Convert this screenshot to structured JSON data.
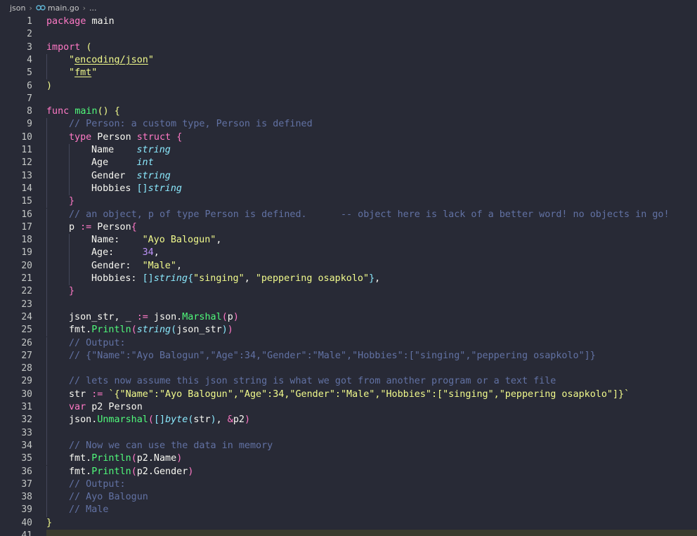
{
  "breadcrumb": {
    "folder": "json",
    "file": "main.go",
    "tail": "..."
  },
  "colors": {
    "background": "#282a36",
    "keyword": "#ff79c6",
    "function": "#50fa7b",
    "type": "#8be9fd",
    "string": "#f1fa8c",
    "number": "#bd93f9",
    "comment": "#6272a4"
  },
  "icons": {
    "go_file": "go-file-icon",
    "separator": "chevron-right-icon"
  },
  "lines": [
    {
      "n": "1",
      "indent": 0,
      "tokens": [
        [
          "kw",
          "package"
        ],
        [
          "pl",
          " main"
        ]
      ]
    },
    {
      "n": "2",
      "indent": 0,
      "tokens": []
    },
    {
      "n": "3",
      "indent": 0,
      "tokens": [
        [
          "kw",
          "import"
        ],
        [
          "pl",
          " "
        ],
        [
          "br1",
          "("
        ]
      ]
    },
    {
      "n": "4",
      "indent": 1,
      "tokens": [
        [
          "str",
          "\""
        ],
        [
          "str ul",
          "encoding/json"
        ],
        [
          "str",
          "\""
        ]
      ]
    },
    {
      "n": "5",
      "indent": 1,
      "tokens": [
        [
          "str",
          "\""
        ],
        [
          "str ul",
          "fmt"
        ],
        [
          "str",
          "\""
        ]
      ]
    },
    {
      "n": "6",
      "indent": 0,
      "tokens": [
        [
          "br1",
          ")"
        ]
      ]
    },
    {
      "n": "7",
      "indent": 0,
      "tokens": []
    },
    {
      "n": "8",
      "indent": 0,
      "tokens": [
        [
          "kw",
          "func"
        ],
        [
          "pl",
          " "
        ],
        [
          "fn",
          "main"
        ],
        [
          "br1",
          "()"
        ],
        [
          "pl",
          " "
        ],
        [
          "br1",
          "{"
        ]
      ]
    },
    {
      "n": "9",
      "indent": 1,
      "tokens": [
        [
          "cm",
          "// Person: a custom type, Person is defined"
        ]
      ]
    },
    {
      "n": "10",
      "indent": 1,
      "tokens": [
        [
          "kw",
          "type"
        ],
        [
          "pl",
          " Person "
        ],
        [
          "kw",
          "struct"
        ],
        [
          "pl",
          " "
        ],
        [
          "br2",
          "{"
        ]
      ]
    },
    {
      "n": "11",
      "indent": 2,
      "tokens": [
        [
          "pl",
          "Name    "
        ],
        [
          "ty",
          "string"
        ]
      ]
    },
    {
      "n": "12",
      "indent": 2,
      "tokens": [
        [
          "pl",
          "Age     "
        ],
        [
          "ty",
          "int"
        ]
      ]
    },
    {
      "n": "13",
      "indent": 2,
      "tokens": [
        [
          "pl",
          "Gender  "
        ],
        [
          "ty",
          "string"
        ]
      ]
    },
    {
      "n": "14",
      "indent": 2,
      "tokens": [
        [
          "pl",
          "Hobbies "
        ],
        [
          "br3",
          "[]"
        ],
        [
          "ty",
          "string"
        ]
      ]
    },
    {
      "n": "15",
      "indent": 1,
      "tokens": [
        [
          "br2",
          "}"
        ]
      ]
    },
    {
      "n": "16",
      "indent": 1,
      "tokens": [
        [
          "cm",
          "// an object, p of type Person is defined.      -- object here is lack of a better word! no objects in go!"
        ]
      ]
    },
    {
      "n": "17",
      "indent": 1,
      "tokens": [
        [
          "pl",
          "p "
        ],
        [
          "kw",
          ":="
        ],
        [
          "pl",
          " Person"
        ],
        [
          "br2",
          "{"
        ]
      ]
    },
    {
      "n": "18",
      "indent": 2,
      "tokens": [
        [
          "pl",
          "Name:    "
        ],
        [
          "str",
          "\"Ayo Balogun\""
        ],
        [
          "pl",
          ","
        ]
      ]
    },
    {
      "n": "19",
      "indent": 2,
      "tokens": [
        [
          "pl",
          "Age:     "
        ],
        [
          "num",
          "34"
        ],
        [
          "pl",
          ","
        ]
      ]
    },
    {
      "n": "20",
      "indent": 2,
      "tokens": [
        [
          "pl",
          "Gender:  "
        ],
        [
          "str",
          "\"Male\""
        ],
        [
          "pl",
          ","
        ]
      ]
    },
    {
      "n": "21",
      "indent": 2,
      "tokens": [
        [
          "pl",
          "Hobbies: "
        ],
        [
          "br3",
          "[]"
        ],
        [
          "ty",
          "string"
        ],
        [
          "br3",
          "{"
        ],
        [
          "str",
          "\"singing\""
        ],
        [
          "pl",
          ", "
        ],
        [
          "str",
          "\"peppering osapkolo\""
        ],
        [
          "br3",
          "}"
        ],
        [
          "pl",
          ","
        ]
      ]
    },
    {
      "n": "22",
      "indent": 1,
      "tokens": [
        [
          "br2",
          "}"
        ]
      ]
    },
    {
      "n": "23",
      "indent": 1,
      "tokens": []
    },
    {
      "n": "24",
      "indent": 1,
      "tokens": [
        [
          "pl",
          "json_str, _ "
        ],
        [
          "kw",
          ":="
        ],
        [
          "pl",
          " json."
        ],
        [
          "fn",
          "Marshal"
        ],
        [
          "br2",
          "("
        ],
        [
          "pl",
          "p"
        ],
        [
          "br2",
          ")"
        ]
      ]
    },
    {
      "n": "25",
      "indent": 1,
      "tokens": [
        [
          "pl",
          "fmt."
        ],
        [
          "fn",
          "Println"
        ],
        [
          "br2",
          "("
        ],
        [
          "ty",
          "string"
        ],
        [
          "br3",
          "("
        ],
        [
          "pl",
          "json_str"
        ],
        [
          "br3",
          ")"
        ],
        [
          "br2",
          ")"
        ]
      ]
    },
    {
      "n": "26",
      "indent": 1,
      "tokens": [
        [
          "cm",
          "// Output:"
        ]
      ]
    },
    {
      "n": "27",
      "indent": 1,
      "tokens": [
        [
          "cm",
          "// {\"Name\":\"Ayo Balogun\",\"Age\":34,\"Gender\":\"Male\",\"Hobbies\":[\"singing\",\"peppering osapkolo\"]}"
        ]
      ]
    },
    {
      "n": "28",
      "indent": 1,
      "tokens": []
    },
    {
      "n": "29",
      "indent": 1,
      "tokens": [
        [
          "cm",
          "// lets now assume this json string is what we got from another program or a text file"
        ]
      ]
    },
    {
      "n": "30",
      "indent": 1,
      "tokens": [
        [
          "pl",
          "str "
        ],
        [
          "kw",
          ":="
        ],
        [
          "pl",
          " "
        ],
        [
          "str",
          "`{\"Name\":\"Ayo Balogun\",\"Age\":34,\"Gender\":\"Male\",\"Hobbies\":[\"singing\",\"peppering osapkolo\"]}`"
        ]
      ]
    },
    {
      "n": "31",
      "indent": 1,
      "tokens": [
        [
          "kw",
          "var"
        ],
        [
          "pl",
          " p2 Person"
        ]
      ]
    },
    {
      "n": "32",
      "indent": 1,
      "tokens": [
        [
          "pl",
          "json."
        ],
        [
          "fn",
          "Unmarshal"
        ],
        [
          "br2",
          "("
        ],
        [
          "br3",
          "[]"
        ],
        [
          "ty",
          "byte"
        ],
        [
          "br3",
          "("
        ],
        [
          "pl",
          "str"
        ],
        [
          "br3",
          ")"
        ],
        [
          "pl",
          ", "
        ],
        [
          "kw",
          "&"
        ],
        [
          "pl",
          "p2"
        ],
        [
          "br2",
          ")"
        ]
      ]
    },
    {
      "n": "33",
      "indent": 1,
      "tokens": []
    },
    {
      "n": "34",
      "indent": 1,
      "tokens": [
        [
          "cm",
          "// Now we can use the data in memory"
        ]
      ]
    },
    {
      "n": "35",
      "indent": 1,
      "tokens": [
        [
          "pl",
          "fmt."
        ],
        [
          "fn",
          "Println"
        ],
        [
          "br2",
          "("
        ],
        [
          "pl",
          "p2.Name"
        ],
        [
          "br2",
          ")"
        ]
      ]
    },
    {
      "n": "36",
      "indent": 1,
      "tokens": [
        [
          "pl",
          "fmt."
        ],
        [
          "fn",
          "Println"
        ],
        [
          "br2",
          "("
        ],
        [
          "pl",
          "p2.Gender"
        ],
        [
          "br2",
          ")"
        ]
      ]
    },
    {
      "n": "37",
      "indent": 1,
      "tokens": [
        [
          "cm",
          "// Output:"
        ]
      ]
    },
    {
      "n": "38",
      "indent": 1,
      "tokens": [
        [
          "cm",
          "// Ayo Balogun"
        ]
      ]
    },
    {
      "n": "39",
      "indent": 1,
      "tokens": [
        [
          "cm",
          "// Male"
        ]
      ]
    },
    {
      "n": "40",
      "indent": 0,
      "tokens": [
        [
          "br1",
          "}"
        ]
      ]
    },
    {
      "n": "41",
      "indent": 0,
      "tokens": []
    }
  ]
}
